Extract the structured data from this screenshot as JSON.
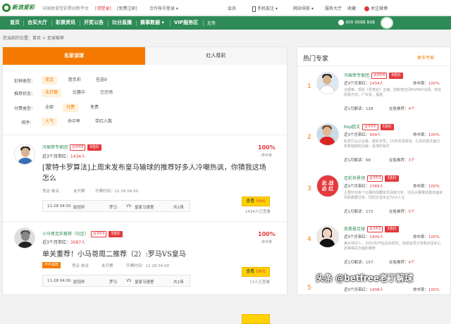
{
  "topbar": {
    "logo": "新浪爱彩",
    "slogan": "中国体育型彩票创新平台",
    "login": "[请登录]",
    "register": "[免费注册]",
    "partner": "合作帐号登录 ▾",
    "member": "会员",
    "mobile": "手机投注 ▾",
    "site_nav": "网站导航 ▾",
    "service": "服务大厅",
    "fav": "收藏",
    "weibo": "关注微博"
  },
  "nav": {
    "items": [
      "首页",
      "合买大厅",
      "彩票资讯",
      "开奖公告",
      "比分直播",
      "赛事数据 ▾",
      "VIP服务区",
      "走势"
    ],
    "phone": "400 6688 848"
  },
  "breadcrumb": "您当前的位置：首页 > 足球推荐",
  "tabs": {
    "active": "名家谈球",
    "inactive": "红人荐彩"
  },
  "filters": [
    {
      "label": "彩种类型：",
      "options": [
        "竞足",
        "胜负彩",
        "任选9"
      ],
      "selected": 0
    },
    {
      "label": "推荐状态：",
      "options": [
        "未开赛",
        "比赛中",
        "已完场"
      ],
      "selected": 0
    },
    {
      "label": "付费类型：",
      "options": [
        "全部",
        "付费",
        "免费"
      ],
      "selected": 1
    },
    {
      "label": "排序：",
      "options": [
        "人气",
        "命中率",
        "带红人数"
      ],
      "selected": 0
    }
  ],
  "posts": [
    {
      "name": "冯振荣专家团",
      "badge1": "近9中8",
      "badge2": "8连红",
      "stat_label": "近3个月带红：",
      "stat_value": "1434人",
      "pct": "100%",
      "pct_label": "命中率",
      "title": "[蒙特卡罗算法]上周末发布皇马输球的推荐好多人冷嘲热讽，你猜我这场怎么",
      "meta1": "竞足-单关",
      "meta2": "未开赛",
      "meta3": "开赛时间：11-28 04:00",
      "match_time": "11-28 04:00",
      "league": "欧冠杯",
      "home": "罗马",
      "vs": "VS",
      "away": "皇家马德里",
      "count": "共1场",
      "buy": "查看",
      "price": "58元",
      "buyers": "1434人已查看"
    },
    {
      "name": "小马哥足彩推荐（社区）",
      "badge1": "近3中3",
      "badge2": "3连红",
      "stat_label": "近3个月带红：",
      "stat_value": "3087人",
      "pct": "100%",
      "pct_label": "命中率",
      "tag": "不中退款",
      "title": "单关重荐！小马哥周二推荐（2）:罗马VS皇马",
      "meta1": "竞足-单关",
      "meta2": "未开赛",
      "meta3": "开赛时间：11-28 04:00",
      "match_time": "11-28 04:00",
      "league": "欧冠杯",
      "home": "罗马",
      "vs": "VS",
      "away": "皇家马德里",
      "count": "共1场",
      "buy": "查看",
      "price": "58元",
      "buyers": "13人已查看"
    }
  ],
  "sidebar": {
    "title": "热门专家",
    "more": "更多专家",
    "experts": [
      {
        "rank": "1",
        "name": "冯振荣专家团",
        "b1": "近9中8",
        "b2": "8连红",
        "stat": "近3个月带红：",
        "stat_v": "1434人",
        "rate": "命中率：",
        "rate_v": "100%",
        "desc": "冯振荣，现任《爱竞彩》主编，前新竞空间ESPN中文网、体坛周报方向，广东省，福建",
        "foot_l": "近1月解读：",
        "foot_lv": "128",
        "foot_r": "在售推荐：",
        "foot_rv": "4个"
      },
      {
        "rank": "2",
        "name": "Kop欧文",
        "b1": "近5中5",
        "b2": "5连红",
        "stat": "近3个月带红：",
        "stat_v": "949人",
        "rate": "命中率：",
        "rate_v": "100%",
        "desc": "彩票行业从业者，欧彩无忧，15年资深球迷，扎实的基本面分析和独到的见解，看准的就打",
        "foot_l": "近1月解读：",
        "foot_lv": "68",
        "foot_r": "在售推荐：",
        "foot_rv": "3个"
      },
      {
        "rank": "3",
        "name": "足彩世界领",
        "b1": "近3中3",
        "b2": "3连红",
        "stat": "近3个月带红：",
        "stat_v": "2389人",
        "rate": "命中率：",
        "rate_v": "100%",
        "desc": "主要针对各个比赛的前瞻资讯深度分析，涉及大量赛前基本面资讯和数据分析，同时打造专业TV只人主",
        "foot_l": "近1月解读：",
        "foot_lv": "172",
        "foot_r": "在售推荐：",
        "foot_rv": "5个"
      },
      {
        "rank": "4",
        "name": "南美曼足球",
        "b1": "近3中3",
        "b2": "3连红",
        "stat": "近3个月带红：",
        "stat_v": "1400人",
        "rate": "命中率：",
        "rate_v": "100%",
        "desc": "美女球评人，2002年开始足彩研究，目前会员分享和对足彩心态等相关方面的推荐",
        "foot_l": "近1月解读：",
        "foot_lv": "157",
        "foot_r": "在售推荐：",
        "foot_rv": "4个"
      },
      {
        "rank": "5",
        "name": "",
        "b1": "",
        "b2": "",
        "stat": "近3个月带红：",
        "stat_v": "1408人",
        "rate": "命中率：",
        "rate_v": "100%",
        "desc": "",
        "foot_l": "",
        "foot_lv": "",
        "foot_r": "",
        "foot_rv": ""
      }
    ]
  },
  "watermark": "头条 @betfree老丁解球",
  "colors": {
    "brand_green": "#2e8b57",
    "accent_orange": "#f57b00",
    "red": "#e4393c"
  }
}
